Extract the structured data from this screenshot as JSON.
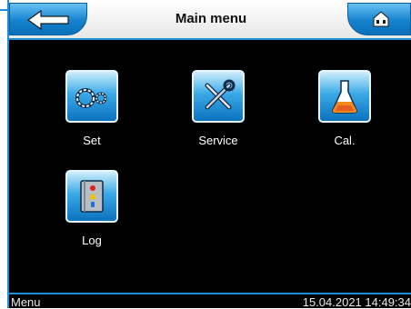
{
  "header": {
    "title": "Main menu"
  },
  "tiles": [
    {
      "label": "Set",
      "icon": "gears-icon"
    },
    {
      "label": "Service",
      "icon": "tools-icon"
    },
    {
      "label": "Cal.",
      "icon": "flask-icon"
    },
    {
      "label": "Log",
      "icon": "logbook-icon"
    }
  ],
  "status": {
    "mode": "Menu",
    "datetime": "15.04.2021 14:49:34"
  },
  "colors": {
    "accent": "#1e8fd6",
    "background": "#000000",
    "button": "#1583cf"
  }
}
